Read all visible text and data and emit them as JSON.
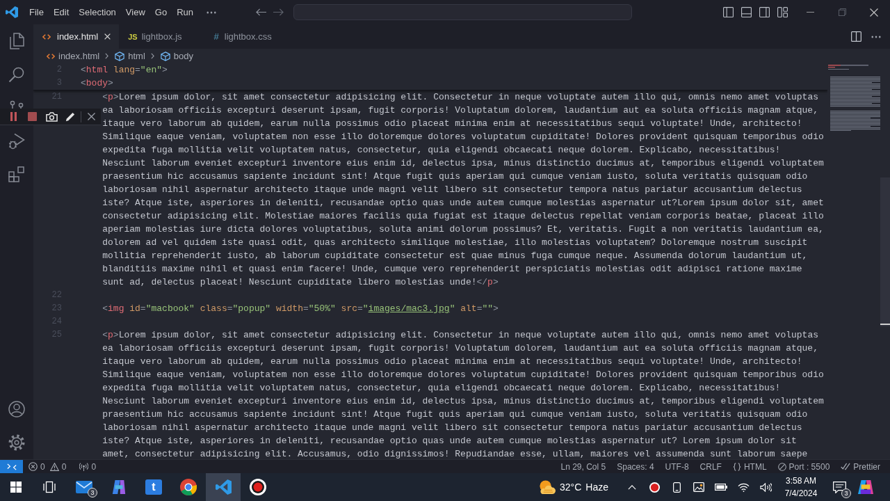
{
  "titlebar": {
    "menu": [
      "File",
      "Edit",
      "Selection",
      "View",
      "Go",
      "Run"
    ]
  },
  "tabs": [
    {
      "label": "index.html",
      "kind": "html",
      "selected": true
    },
    {
      "label": "lightbox.js",
      "kind": "js",
      "icon_text": "JS",
      "selected": false
    },
    {
      "label": "lightbox.css",
      "kind": "css",
      "icon_text": "#",
      "selected": false
    }
  ],
  "breadcrumbs": [
    {
      "label": "index.html",
      "kind": "file"
    },
    {
      "label": "html",
      "kind": "element"
    },
    {
      "label": "body",
      "kind": "element"
    }
  ],
  "sticky_scroll": [
    {
      "number": "2",
      "tokens": [
        {
          "kind": "punct",
          "text": "<"
        },
        {
          "kind": "tag",
          "text": "html "
        },
        {
          "kind": "attr",
          "text": "lang"
        },
        {
          "kind": "punct",
          "text": "="
        },
        {
          "kind": "string",
          "text": "\"en\""
        },
        {
          "kind": "punct",
          "text": ">"
        }
      ]
    },
    {
      "number": "3",
      "tokens": [
        {
          "kind": "punct",
          "text": "<"
        },
        {
          "kind": "tag",
          "text": "body"
        },
        {
          "kind": "punct",
          "text": ">"
        }
      ]
    }
  ],
  "code_lines": [
    {
      "number": "21",
      "rows": [
        {
          "tokens": [
            {
              "kind": "punct",
              "text": "    <"
            },
            {
              "kind": "tag",
              "text": "p"
            },
            {
              "kind": "punct",
              "text": ">"
            },
            {
              "kind": "text",
              "text": "Lorem ipsum dolor, sit amet consectetur adipisicing elit. Consectetur in neque voluptate autem illo qui, omnis nemo amet voluptas"
            }
          ]
        },
        {
          "tokens": [
            {
              "kind": "text",
              "text": "ea laboriosam officiis excepturi deserunt ipsam, fugit corporis! Voluptatum dolorem, laudantium aut ea soluta officiis magnam atque,"
            }
          ]
        },
        {
          "tokens": [
            {
              "kind": "text",
              "text": "itaque vero laborum ab quidem, earum nulla possimus odio placeat minima enim at necessitatibus sequi voluptate! Unde, architecto!"
            }
          ]
        },
        {
          "tokens": [
            {
              "kind": "text",
              "text": "Similique eaque veniam, voluptatem non esse illo doloremque dolores voluptatum cupiditate! Dolores provident quisquam temporibus odio"
            }
          ]
        },
        {
          "tokens": [
            {
              "kind": "text",
              "text": "expedita fuga mollitia velit voluptatem natus, consectetur, quia eligendi obcaecati neque dolorem. Explicabo, necessitatibus!"
            }
          ]
        },
        {
          "tokens": [
            {
              "kind": "text",
              "text": "Nesciunt laborum eveniet excepturi inventore eius enim id, delectus ipsa, minus distinctio ducimus at, temporibus eligendi voluptatem"
            }
          ]
        },
        {
          "tokens": [
            {
              "kind": "text",
              "text": "praesentium hic accusamus sapiente incidunt sint! Atque fugit quis aperiam qui cumque veniam iusto, soluta veritatis quisquam odio"
            }
          ]
        },
        {
          "tokens": [
            {
              "kind": "text",
              "text": "laboriosam nihil aspernatur architecto itaque unde magni velit libero sit consectetur tempora natus pariatur accusantium delectus"
            }
          ]
        },
        {
          "tokens": [
            {
              "kind": "text",
              "text": "iste? Atque iste, asperiores in deleniti, recusandae optio quas unde autem cumque molestias aspernatur ut?Lorem ipsum dolor sit, amet"
            }
          ]
        },
        {
          "tokens": [
            {
              "kind": "text",
              "text": "consectetur adipisicing elit. Molestiae maiores facilis quia fugiat est itaque delectus repellat veniam corporis beatae, placeat illo"
            }
          ]
        },
        {
          "tokens": [
            {
              "kind": "text",
              "text": "aperiam molestias iure dicta dolores voluptatibus, soluta animi dolorum possimus? Et, veritatis. Fugit a non veritatis laudantium ea,"
            }
          ]
        },
        {
          "tokens": [
            {
              "kind": "text",
              "text": "dolorem ad vel quidem iste quasi odit, quas architecto similique molestiae, illo molestias voluptatem? Doloremque nostrum suscipit"
            }
          ]
        },
        {
          "tokens": [
            {
              "kind": "text",
              "text": "mollitia reprehenderit iusto, ab laborum cupiditate consectetur est quae minus fuga cumque neque. Assumenda dolorum laudantium ut,"
            }
          ]
        },
        {
          "tokens": [
            {
              "kind": "text",
              "text": "blanditiis maxime nihil et quasi enim facere! Unde, cumque vero reprehenderit perspiciatis molestias odit adipisci ratione maxime"
            }
          ]
        },
        {
          "tokens": [
            {
              "kind": "text",
              "text": "sunt ad, delectus placeat! Nesciunt cupiditate libero molestias unde!"
            },
            {
              "kind": "punct",
              "text": "</"
            },
            {
              "kind": "tag",
              "text": "p"
            },
            {
              "kind": "punct",
              "text": ">"
            }
          ]
        }
      ]
    },
    {
      "number": "22"
    },
    {
      "number": "23",
      "rows": [
        {
          "tokens": [
            {
              "kind": "punct",
              "text": "    <"
            },
            {
              "kind": "tag",
              "text": "img "
            },
            {
              "kind": "attr",
              "text": "id"
            },
            {
              "kind": "punct",
              "text": "="
            },
            {
              "kind": "string",
              "text": "\"macbook\" "
            },
            {
              "kind": "attr",
              "text": "class"
            },
            {
              "kind": "punct",
              "text": "="
            },
            {
              "kind": "string",
              "text": "\"popup\" "
            },
            {
              "kind": "attr",
              "text": "width"
            },
            {
              "kind": "punct",
              "text": "="
            },
            {
              "kind": "string",
              "text": "\"50%\" "
            },
            {
              "kind": "attr",
              "text": "src"
            },
            {
              "kind": "punct",
              "text": "="
            },
            {
              "kind": "string",
              "text": "\""
            },
            {
              "kind": "link",
              "text": "images/mac3.jpg"
            },
            {
              "kind": "string",
              "text": "\" "
            },
            {
              "kind": "attr",
              "text": "alt"
            },
            {
              "kind": "punct",
              "text": "="
            },
            {
              "kind": "string",
              "text": "\"\""
            },
            {
              "kind": "punct",
              "text": ">"
            }
          ]
        }
      ]
    },
    {
      "number": "24"
    },
    {
      "number": "25",
      "rows": [
        {
          "tokens": [
            {
              "kind": "punct",
              "text": "    <"
            },
            {
              "kind": "tag",
              "text": "p"
            },
            {
              "kind": "punct",
              "text": ">"
            },
            {
              "kind": "text",
              "text": "Lorem ipsum dolor, sit amet consectetur adipisicing elit. Consectetur in neque voluptate autem illo qui, omnis nemo amet voluptas"
            }
          ]
        },
        {
          "tokens": [
            {
              "kind": "text",
              "text": "ea laboriosam officiis excepturi deserunt ipsam, fugit corporis! Voluptatum dolorem, laudantium aut ea soluta officiis magnam atque,"
            }
          ]
        },
        {
          "tokens": [
            {
              "kind": "text",
              "text": "itaque vero laborum ab quidem, earum nulla possimus odio placeat minima enim at necessitatibus sequi voluptate! Unde, architecto!"
            }
          ]
        },
        {
          "tokens": [
            {
              "kind": "text",
              "text": "Similique eaque veniam, voluptatem non esse illo doloremque dolores voluptatum cupiditate! Dolores provident quisquam temporibus odio"
            }
          ]
        },
        {
          "tokens": [
            {
              "kind": "text",
              "text": "expedita fuga mollitia velit voluptatem natus, consectetur, quia eligendi obcaecati neque dolorem. Explicabo, necessitatibus!"
            }
          ]
        },
        {
          "tokens": [
            {
              "kind": "text",
              "text": "Nesciunt laborum eveniet excepturi inventore eius enim id, delectus ipsa, minus distinctio ducimus at, temporibus eligendi voluptatem"
            }
          ]
        },
        {
          "tokens": [
            {
              "kind": "text",
              "text": "praesentium hic accusamus sapiente incidunt sint! Atque fugit quis aperiam qui cumque veniam iusto, soluta veritatis quisquam odio"
            }
          ]
        },
        {
          "tokens": [
            {
              "kind": "text",
              "text": "laboriosam nihil aspernatur architecto itaque unde magni velit libero sit consectetur tempora natus pariatur accusantium delectus"
            }
          ]
        },
        {
          "tokens": [
            {
              "kind": "text",
              "text": "iste? Atque iste, asperiores in deleniti, recusandae optio quas unde autem cumque molestias aspernatur ut? Lorem ipsum dolor sit"
            }
          ]
        },
        {
          "tokens": [
            {
              "kind": "text",
              "text": "amet, consectetur adipisicing elit. Accusamus, odio dignissimos! Repudiandae esse, ullam, maiores vel assumenda sunt laborum saepe"
            }
          ]
        }
      ]
    }
  ],
  "status_bar": {
    "problems": {
      "errors": "0",
      "warnings": "0"
    },
    "ports": "0",
    "items": [
      {
        "kind": "text",
        "text": "Ln 29, Col 5"
      },
      {
        "kind": "text",
        "text": "Spaces: 4"
      },
      {
        "kind": "text",
        "text": "UTF-8"
      },
      {
        "kind": "text",
        "text": "CRLF"
      },
      {
        "kind": "language",
        "text": "HTML"
      },
      {
        "kind": "port",
        "text": "Port : 5500"
      },
      {
        "kind": "formatter",
        "text": "Prettier"
      }
    ]
  },
  "taskbar": {
    "apps": [
      {
        "kind": "start",
        "selected": false
      },
      {
        "kind": "task-view",
        "selected": false
      },
      {
        "kind": "mail",
        "badge": "3",
        "selected": false
      },
      {
        "kind": "copilot",
        "selected": false
      },
      {
        "kind": "tile",
        "text": "t",
        "selected": false
      },
      {
        "kind": "chrome",
        "selected": false
      },
      {
        "kind": "code",
        "selected": true
      },
      {
        "kind": "recorder",
        "selected": false
      }
    ],
    "weather": {
      "temperature": "32°C",
      "condition": "Haze"
    },
    "tray": [
      {
        "kind": "chevron"
      },
      {
        "kind": "recorder"
      },
      {
        "kind": "phone"
      },
      {
        "kind": "picture"
      },
      {
        "kind": "battery"
      },
      {
        "kind": "wifi"
      },
      {
        "kind": "speaker"
      }
    ],
    "clock": {
      "time": "3:58 AM",
      "date": "7/4/2024"
    },
    "notifications": {
      "badge": "3"
    }
  }
}
